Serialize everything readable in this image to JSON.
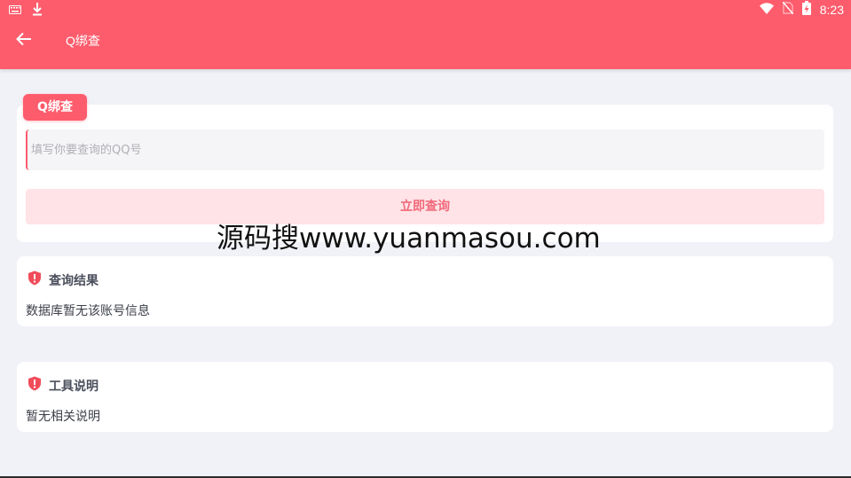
{
  "status_bar": {
    "time": "8:23",
    "left_icons": [
      "keyboard-icon",
      "download-icon"
    ],
    "right_icons": [
      "wifi-icon",
      "no-sim-icon",
      "battery-charging-icon"
    ]
  },
  "toolbar": {
    "title": "Q绑查",
    "back_icon": "arrow-left-icon"
  },
  "query_card": {
    "tag_label": "Q绑查",
    "input_placeholder": "填写你要查询的QQ号",
    "input_value": "",
    "submit_label": "立即查询"
  },
  "watermark": "源码搜www.yuanmasou.com",
  "result_card": {
    "title": "查询结果",
    "body": "数据库暂无该账号信息",
    "icon": "shield-alert-icon"
  },
  "tool_card": {
    "title": "工具说明",
    "body": "暂无相关说明",
    "icon": "shield-alert-icon"
  },
  "colors": {
    "accent": "#fd5c6c",
    "button_bg": "#ffe3e6",
    "button_text": "#f2687a",
    "page_bg": "#f1f2f7"
  }
}
